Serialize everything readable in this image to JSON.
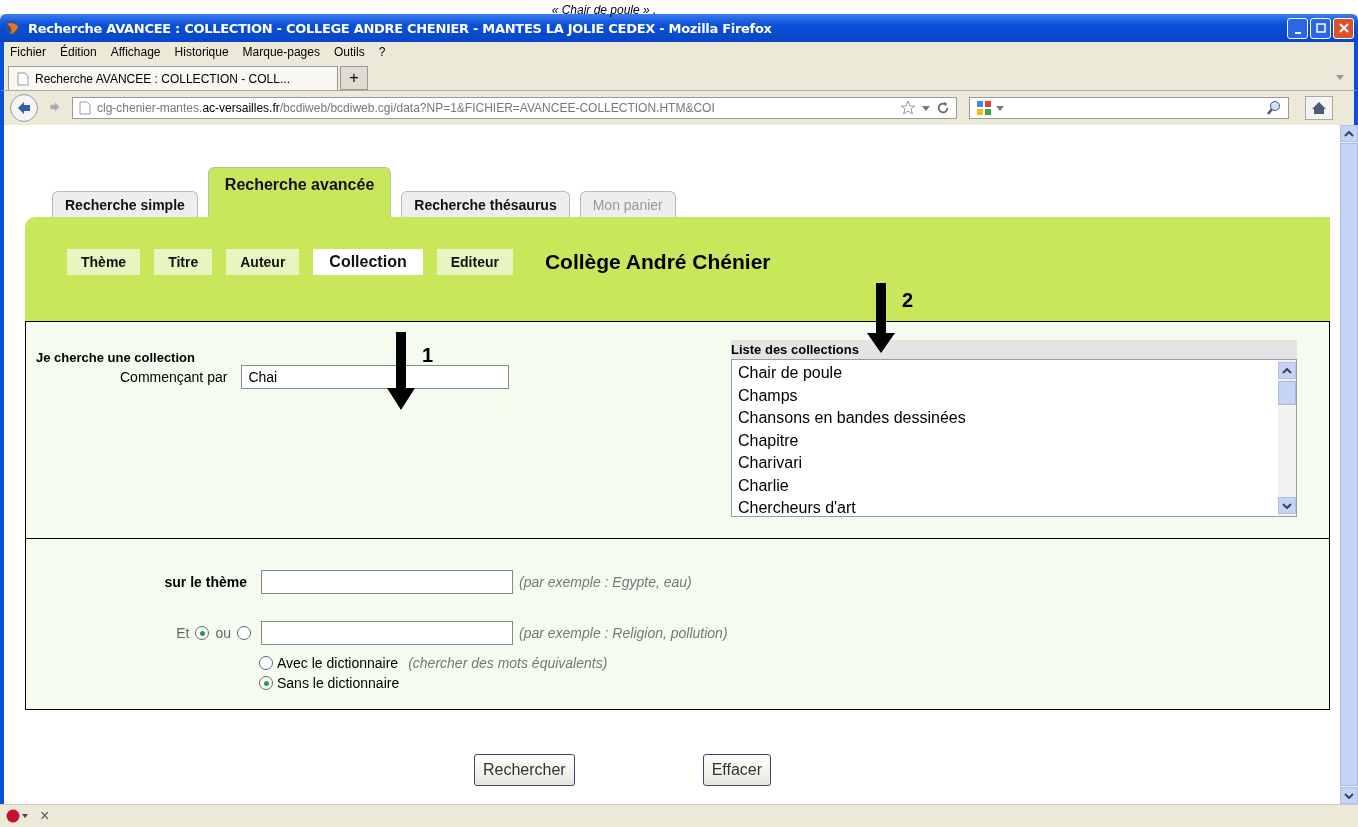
{
  "caption": "« Chair de poule » .",
  "window": {
    "title": "Recherche AVANCEE : COLLECTION - COLLEGE ANDRE CHENIER - MANTES LA JOLIE CEDEX - Mozilla Firefox"
  },
  "menu": [
    "Fichier",
    "Édition",
    "Affichage",
    "Historique",
    "Marque-pages",
    "Outils",
    "?"
  ],
  "browser_tabs": [
    {
      "label": "Recherche AVANCEE : COLLECTION - COLL...",
      "selected": true
    }
  ],
  "new_tab": "+",
  "address": {
    "url": "clg-chenier-mantes.**ac-versailles.fr**/bcdiweb/bcdiweb.cgi/data?NP=1&FICHIER=AVANCEE-COLLECTION.HTM&COI"
  },
  "page_tabs": [
    {
      "label": "Recherche simple",
      "selected": false,
      "disabled": false
    },
    {
      "label": "Recherche avancée",
      "selected": true,
      "disabled": false
    },
    {
      "label": "Recherche thésaurus",
      "selected": false,
      "disabled": false
    },
    {
      "label": "Mon panier",
      "selected": false,
      "disabled": true
    }
  ],
  "sub_tabs": [
    {
      "label": "Thème",
      "selected": false
    },
    {
      "label": "Titre",
      "selected": false
    },
    {
      "label": "Auteur",
      "selected": false
    },
    {
      "label": "Collection",
      "selected": true
    },
    {
      "label": "Editeur",
      "selected": false
    }
  ],
  "site_title": "Collège André Chénier",
  "collection_search": {
    "heading": "Je cherche une collection",
    "label": "Commençant par",
    "value": "Chai"
  },
  "collections_list": {
    "heading": "Liste des collections",
    "items": [
      "Chair de poule",
      "Champs",
      "Chansons en bandes dessinées",
      "Chapitre",
      "Charivari",
      "Charlie",
      "Chercheurs d'art"
    ]
  },
  "theme": {
    "label": "sur le thème",
    "hint": "(par exemple : Egypte, eau)"
  },
  "operators": [
    {
      "label": "Et",
      "selected": true
    },
    {
      "label": "ou",
      "selected": false
    }
  ],
  "theme2": {
    "hint": "(par exemple : Religion, pollution)"
  },
  "dictionary_options": [
    {
      "label": "Avec le dictionnaire",
      "note": "(chercher des mots équivalents)",
      "selected": false
    },
    {
      "label": "Sans le dictionnaire",
      "selected": true
    }
  ],
  "buttons": [
    "Rechercher",
    "Effacer"
  ],
  "annotations": [
    {
      "label": "1"
    },
    {
      "label": "2"
    }
  ],
  "status_bar": {
    "close": "×"
  }
}
